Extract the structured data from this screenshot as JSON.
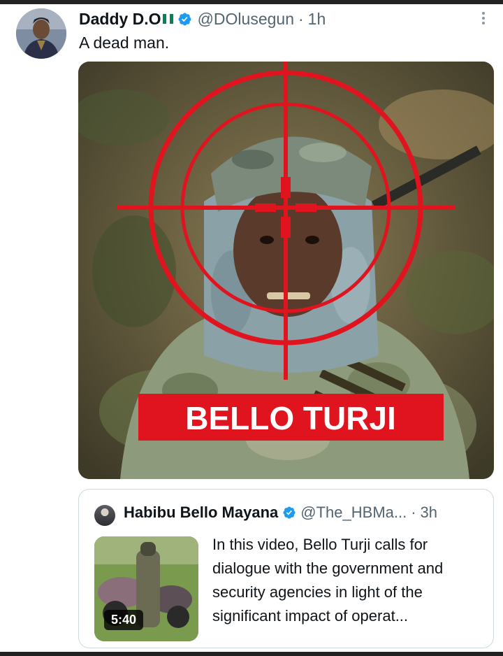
{
  "tweet": {
    "author_name": "Daddy D.O",
    "author_handle": "@DOlusegun",
    "separator": "·",
    "time": "1h",
    "text": "A dead man.",
    "media_caption": "BELLO TURJI"
  },
  "quoted_tweet": {
    "author_name": "Habibu Bello Mayana",
    "author_handle": "@The_HBMa...",
    "separator": "·",
    "time": "3h",
    "text": "In this video, Bello Turji calls for dialogue with the government and security agencies in light of the significant impact of operat...",
    "video_duration": "5:40"
  },
  "icons": {
    "verified": "verified-badge-icon",
    "flag": "nigeria-flag-icon",
    "more": "more-vertical-icon"
  },
  "colors": {
    "verified_blue": "#1d9bf0",
    "crosshair_red": "#e0141e",
    "muted_text": "#536471"
  }
}
